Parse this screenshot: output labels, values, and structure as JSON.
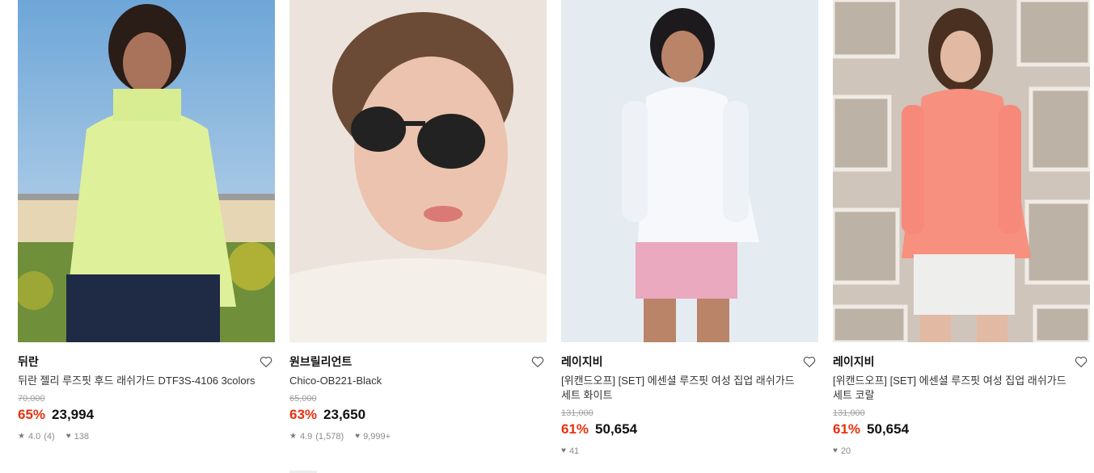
{
  "products": [
    {
      "brand": "뒤란",
      "title": "뒤란 젤리 루즈핏 후드 래쉬가드 DTF3S-4106 3colors",
      "original_price": "70,000",
      "discount": "65%",
      "price": "23,994",
      "rating": "4.0",
      "review_count": "(4)",
      "likes": "138"
    },
    {
      "brand": "원브릴리언트",
      "title": "Chico-OB221-Black",
      "original_price": "65,000",
      "discount": "63%",
      "price": "23,650",
      "rating": "4.9",
      "review_count": "(1,578)",
      "likes": "9,999+"
    },
    {
      "brand": "레이지비",
      "title": "[위캔드오프] [SET] 에센셜 루즈핏 여성 집업 래쉬가드 세트 화이트",
      "original_price": "131,000",
      "discount": "61%",
      "price": "50,654",
      "likes": "41"
    },
    {
      "brand": "레이지비",
      "title": "[위캔드오프] [SET] 에센셜 루즈핏 여성 집업 래쉬가드 세트 코랄",
      "original_price": "131,000",
      "discount": "61%",
      "price": "50,654",
      "likes": "20"
    }
  ],
  "icons": {
    "wishlist": "heart-outline-icon",
    "rating": "star-icon",
    "likes": "heart-filled-icon"
  },
  "colors": {
    "discount": "#e8300e",
    "price": "#111111",
    "muted": "#8a8a8a"
  }
}
